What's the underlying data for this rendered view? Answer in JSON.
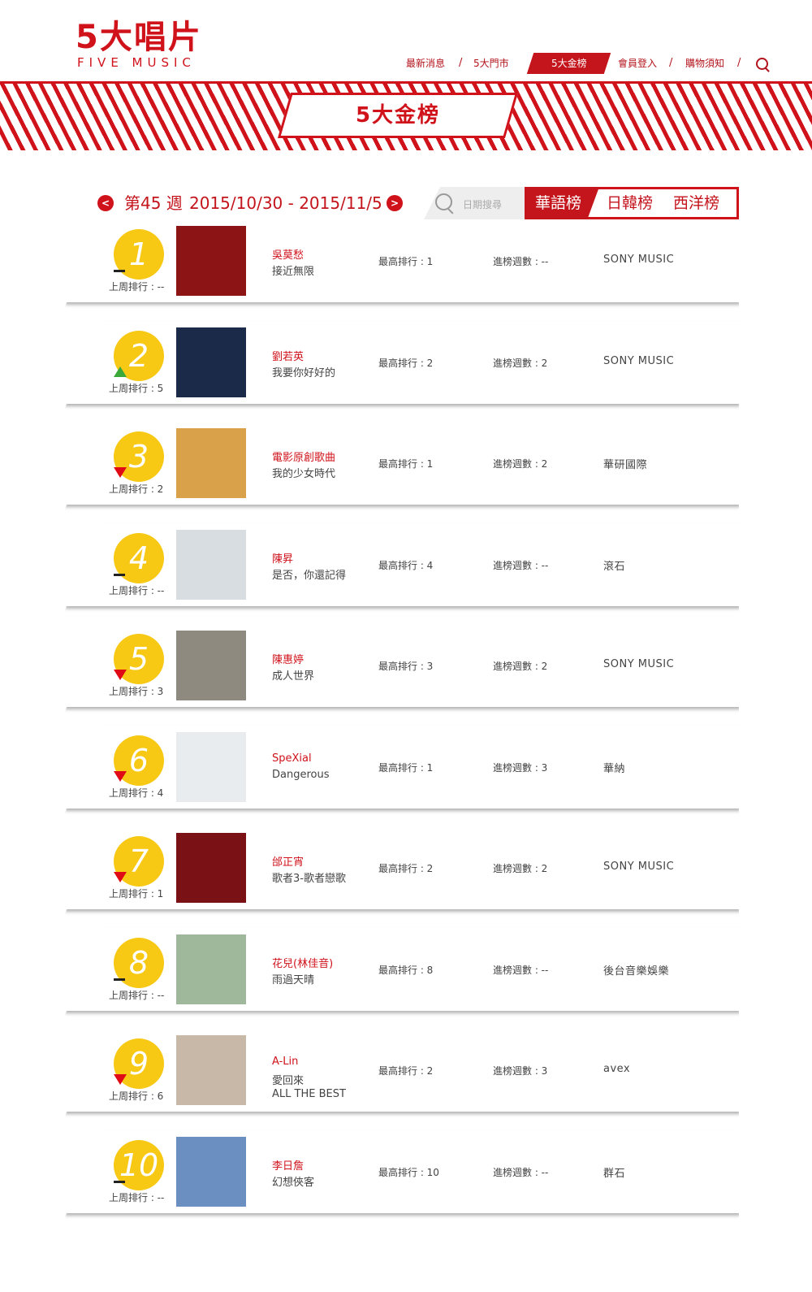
{
  "logo": {
    "cn": "5大唱片",
    "en": "FIVE MUSIC"
  },
  "nav": {
    "news": "最新消息",
    "stores": "5大門市",
    "charts": "5大金榜",
    "login": "會員登入",
    "shopping": "購物須知",
    "sep": "/"
  },
  "banner_title": "5大金榜",
  "week": {
    "label": "第45 週",
    "range": "2015/10/30 - 2015/11/5",
    "prev": "<",
    "next": ">"
  },
  "search": {
    "placeholder": "日期搜尋"
  },
  "tabs": [
    "華語榜",
    "日韓榜",
    "西洋榜"
  ],
  "row_labels": {
    "last": "上周排行 : ",
    "peak": "最高排行 : ",
    "weeks": "進榜週數 : "
  },
  "colors": {
    "brand_red": "#d0121b",
    "rank_yellow": "#f7c814",
    "up": "#3aa93a",
    "down": "#e00a16"
  },
  "chart_rows": [
    {
      "rank": "1",
      "trend": "flat",
      "last_week": "上周排行 : --",
      "artist": "吳莫愁",
      "album": "接近無限",
      "album2": "",
      "peak": "最高排行 : 1",
      "weeks": "進榜週數 : --",
      "label": "SONY MUSIC",
      "cover": "#8c1414"
    },
    {
      "rank": "2",
      "trend": "up",
      "last_week": "上周排行 : 5",
      "artist": "劉若英",
      "album": "我要你好好的",
      "album2": "",
      "peak": "最高排行 : 2",
      "weeks": "進榜週數 : 2",
      "label": "SONY MUSIC",
      "cover": "#1c2a4a"
    },
    {
      "rank": "3",
      "trend": "down",
      "last_week": "上周排行 : 2",
      "artist": "電影原創歌曲",
      "album": "我的少女時代",
      "album2": "",
      "peak": "最高排行 : 1",
      "weeks": "進榜週數 : 2",
      "label": "華研國際",
      "cover": "#d9a24a"
    },
    {
      "rank": "4",
      "trend": "flat",
      "last_week": "上周排行 : --",
      "artist": "陳昇",
      "album": "是否，你還記得",
      "album2": "",
      "peak": "最高排行 : 4",
      "weeks": "進榜週數 : --",
      "label": "滾石",
      "cover": "#d8dde2"
    },
    {
      "rank": "5",
      "trend": "down",
      "last_week": "上周排行 : 3",
      "artist": "陳惠婷",
      "album": "成人世界",
      "album2": "",
      "peak": "最高排行 : 3",
      "weeks": "進榜週數 : 2",
      "label": "SONY MUSIC",
      "cover": "#8f8a80"
    },
    {
      "rank": "6",
      "trend": "down",
      "last_week": "上周排行 : 4",
      "artist": "SpeXial",
      "album": "Dangerous",
      "album2": "",
      "peak": "最高排行 : 1",
      "weeks": "進榜週數 : 3",
      "label": "華納",
      "cover": "#e8ecef"
    },
    {
      "rank": "7",
      "trend": "down",
      "last_week": "上周排行 : 1",
      "artist": "邰正宵",
      "album": "歌者3-歌者戀歌",
      "album2": "",
      "peak": "最高排行 : 2",
      "weeks": "進榜週數 : 2",
      "label": "SONY MUSIC",
      "cover": "#7a1114"
    },
    {
      "rank": "8",
      "trend": "flat",
      "last_week": "上周排行 : --",
      "artist": "花兒(林佳音)",
      "album": "雨過天晴",
      "album2": "",
      "peak": "最高排行 : 8",
      "weeks": "進榜週數 : --",
      "label": "後台音樂娛樂",
      "cover": "#9fb79a"
    },
    {
      "rank": "9",
      "trend": "down",
      "last_week": "上周排行 : 6",
      "artist": "A-Lin",
      "album": "愛回來",
      "album2": "ALL THE BEST",
      "peak": "最高排行 : 2",
      "weeks": "進榜週數 : 3",
      "label": "avex",
      "cover": "#c8b8a8"
    },
    {
      "rank": "10",
      "trend": "flat",
      "last_week": "上周排行 : --",
      "artist": "李日詹",
      "album": "幻想俠客",
      "album2": "",
      "peak": "最高排行 : 10",
      "weeks": "進榜週數 : --",
      "label": "群石",
      "cover": "#6a8fc0"
    }
  ]
}
